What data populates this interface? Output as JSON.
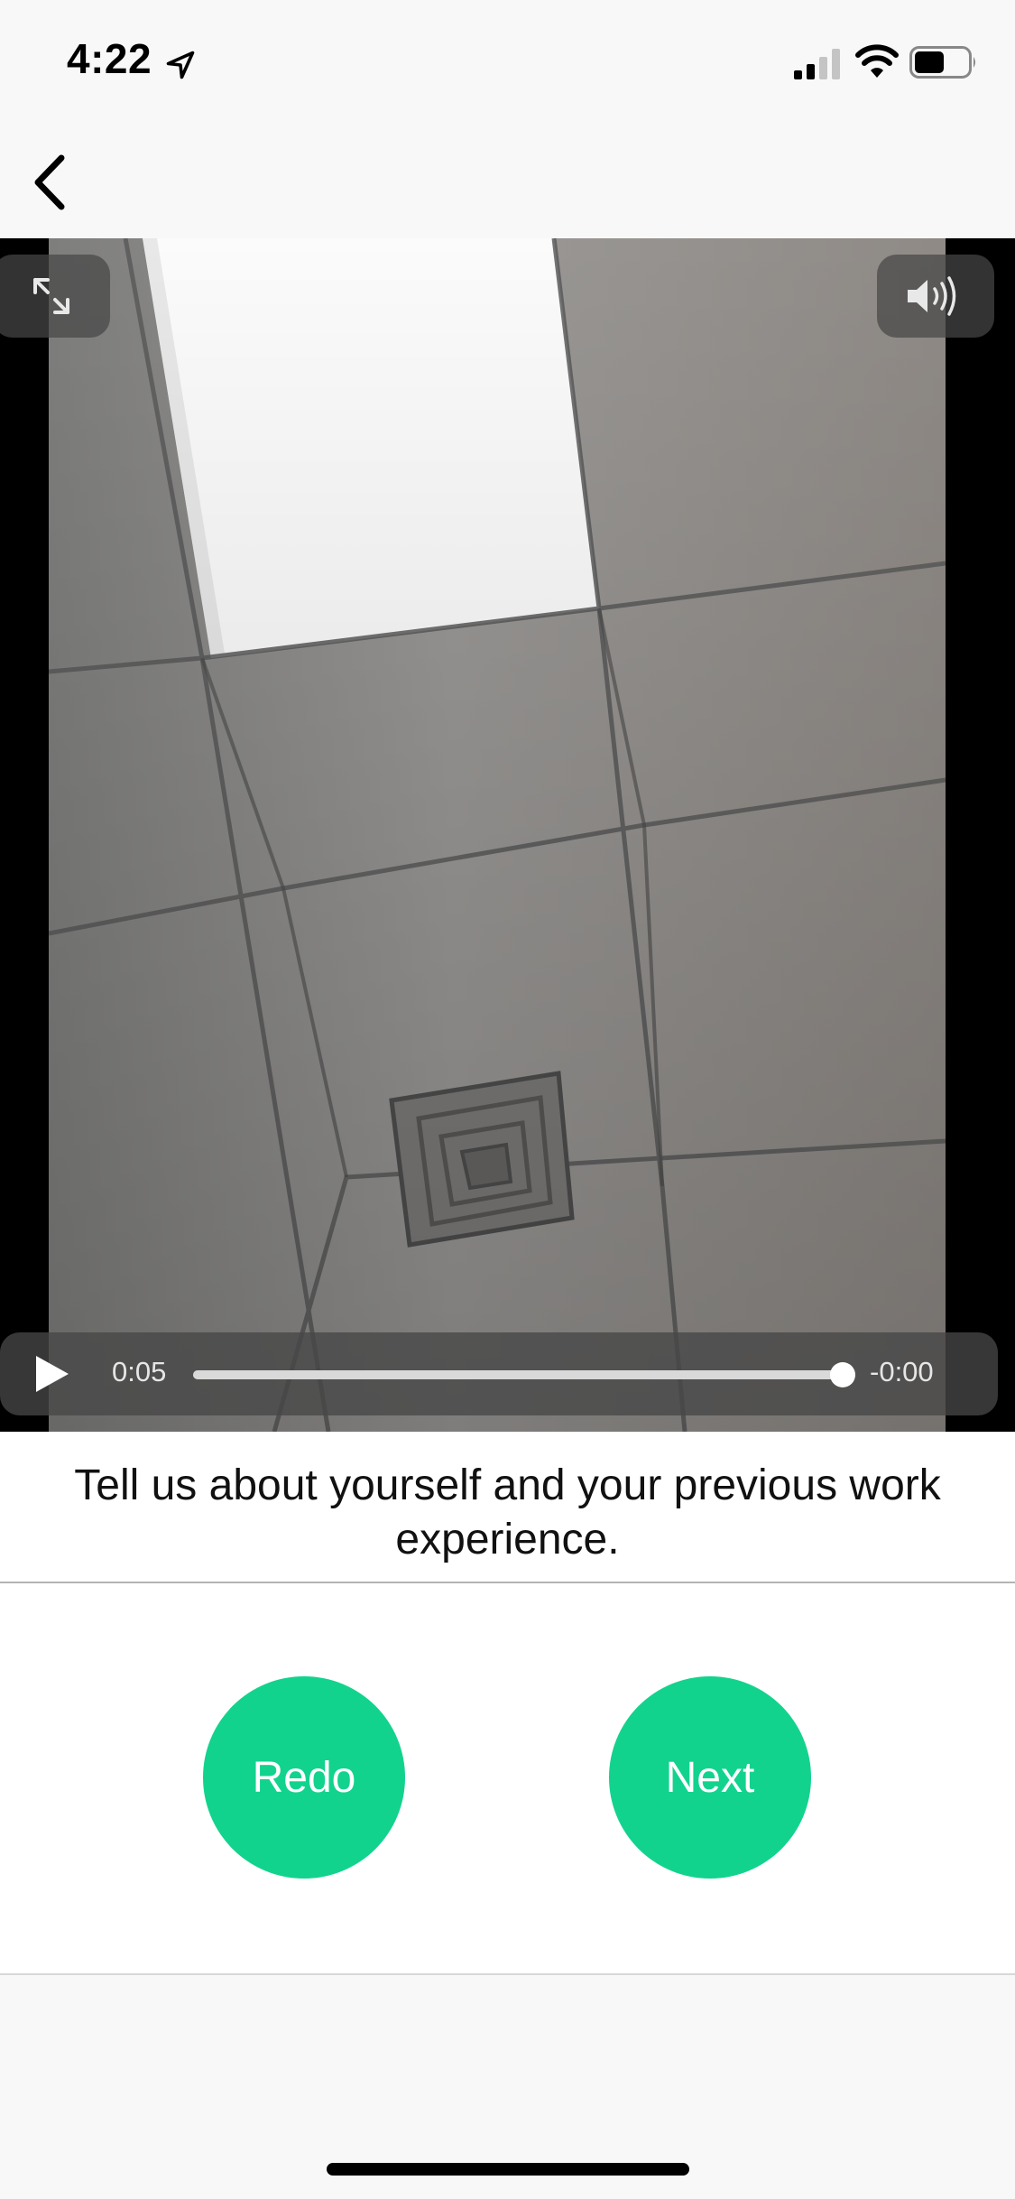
{
  "status_bar": {
    "time": "4:22",
    "icons": [
      "location-arrow-icon",
      "cellular-signal-icon",
      "wifi-icon",
      "battery-icon"
    ]
  },
  "nav": {
    "back_icon": "chevron-left-icon"
  },
  "video": {
    "elapsed": "0:05",
    "remaining": "-0:00",
    "progress": 1.0,
    "icons": [
      "expand-icon",
      "speaker-icon",
      "play-icon"
    ]
  },
  "question": {
    "text": "Tell us about yourself and your previous work experience."
  },
  "actions": {
    "redo_label": "Redo",
    "next_label": "Next"
  },
  "colors": {
    "accent": "#12d38e",
    "background": "#f8f8f8",
    "text": "#111111"
  }
}
